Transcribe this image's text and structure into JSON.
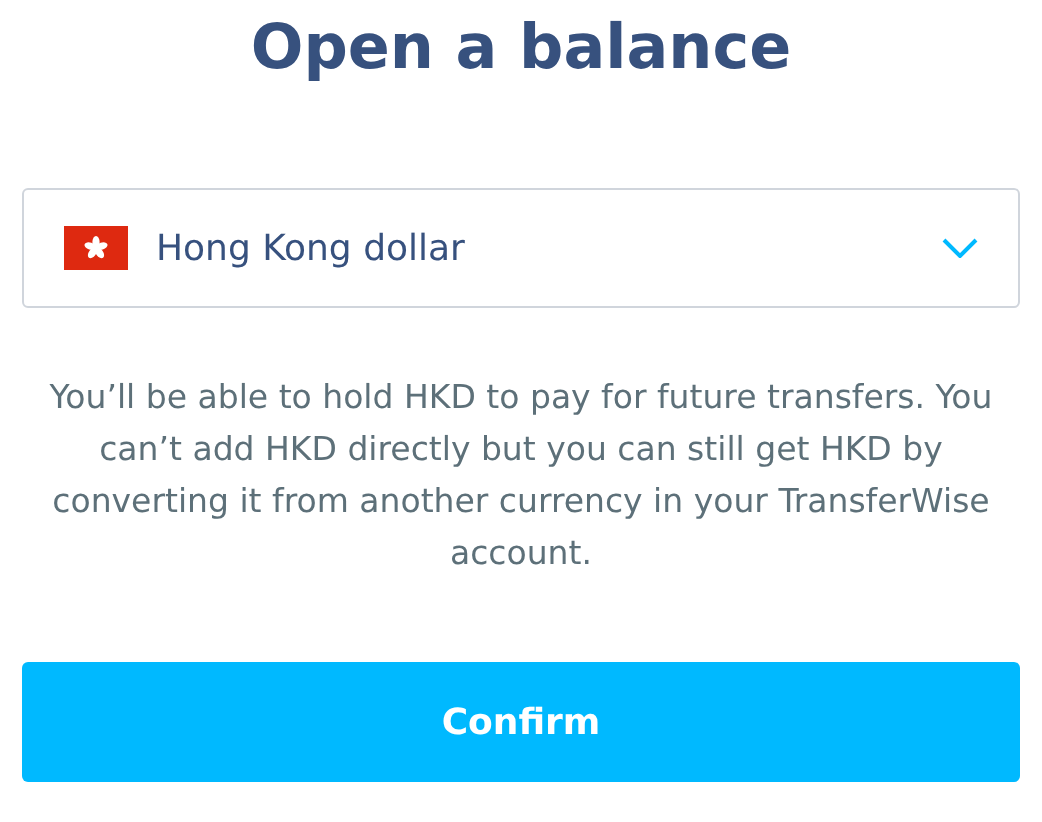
{
  "title": "Open a balance",
  "currency_select": {
    "value": "Hong Kong dollar"
  },
  "description": "You’ll be able to hold HKD to pay for future transfers. You can’t add HKD directly but you can still get HKD by converting it from another currency in your TransferWise account.",
  "buttons": [
    "Confirm"
  ]
}
